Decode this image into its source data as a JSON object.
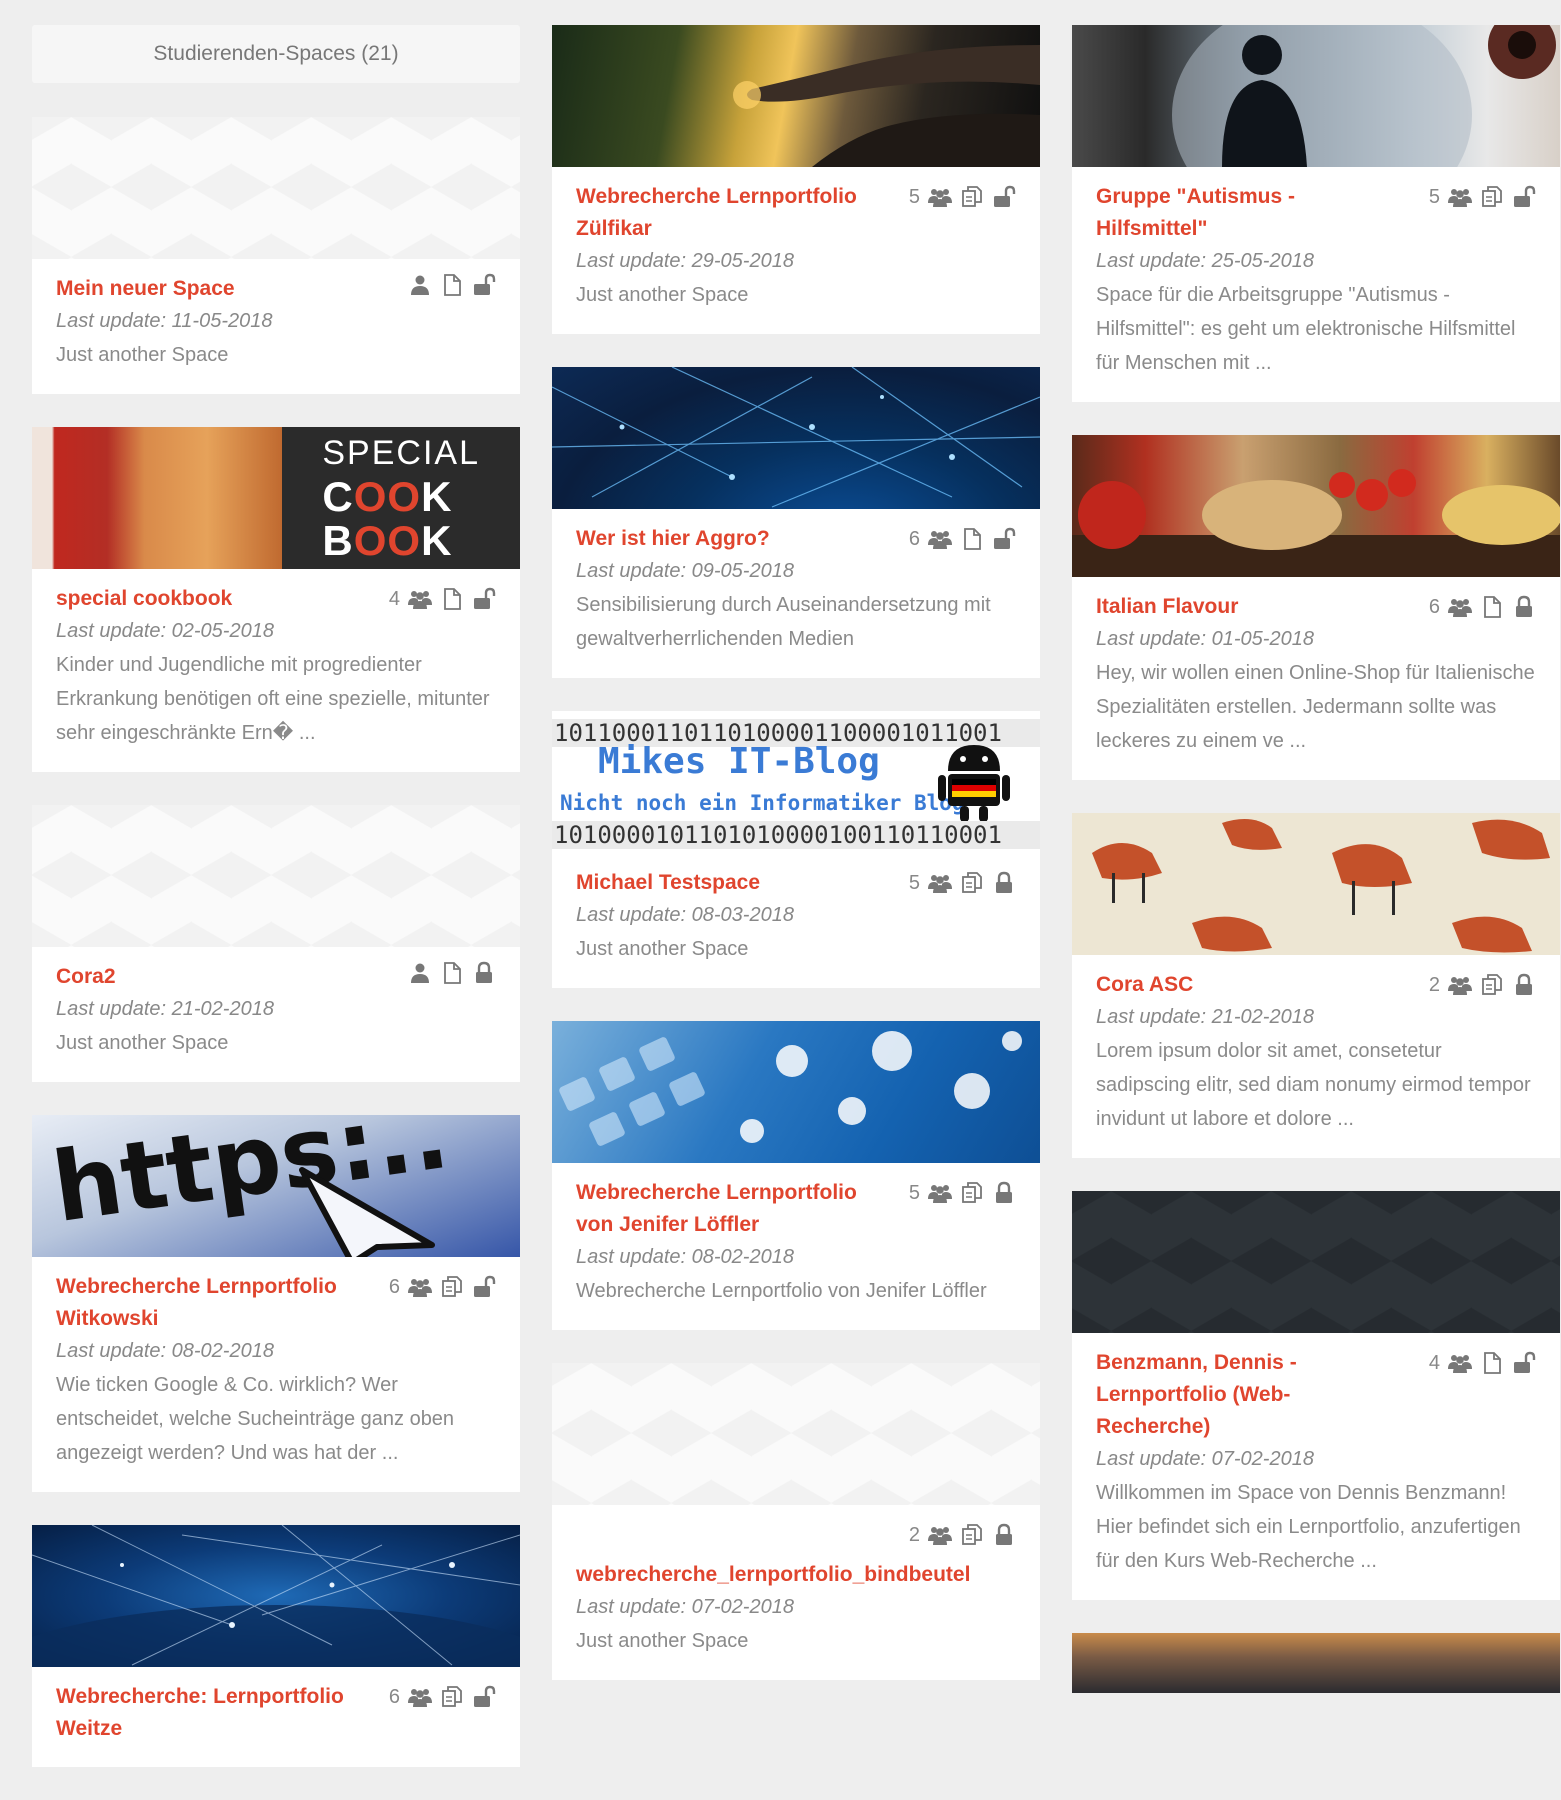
{
  "header": {
    "label": "Studierenden-Spaces (21)"
  },
  "colors": {
    "accent": "#e0452e",
    "meta_text": "#888888",
    "background": "#eeeeee"
  },
  "cards": {
    "c0_0": {
      "title": "Mein neuer Space",
      "member_count": "",
      "member_icon": "user-icon",
      "pages_icon": "page-icon",
      "lock_icon": "unlock-icon",
      "date": "Last update: 11-05-2018",
      "desc": "Just another Space"
    },
    "c0_1": {
      "title": "special cookbook",
      "member_count": "4",
      "member_icon": "users-icon",
      "pages_icon": "page-icon",
      "lock_icon": "unlock-icon",
      "date": "Last update: 02-05-2018",
      "desc": "Kinder und Jugendliche mit progredienter Erkrankung benötigen oft eine spezielle, mitunter sehr eingeschränkte Ern� ...",
      "image_text": {
        "line1": "SPECIAL",
        "line2": "COOK",
        "line3": "BOOK"
      }
    },
    "c0_2": {
      "title": "Cora2",
      "member_count": "",
      "member_icon": "user-icon",
      "pages_icon": "page-icon",
      "lock_icon": "lock-icon",
      "date": "Last update: 21-02-2018",
      "desc": "Just another Space"
    },
    "c0_3": {
      "title": "Webrecherche Lernportfolio Witkowski",
      "member_count": "6",
      "member_icon": "users-icon",
      "pages_icon": "copy-icon",
      "lock_icon": "unlock-icon",
      "date": "Last update: 08-02-2018",
      "desc": "Wie ticken Google & Co. wirklich? Wer entscheidet, welche Sucheinträge ganz oben angezeigt werden? Und was hat der ...",
      "image_text": "https:.."
    },
    "c0_4": {
      "title": "Webrecherche: Lernportfolio Weitze",
      "member_count": "6",
      "member_icon": "users-icon",
      "pages_icon": "copy-icon",
      "lock_icon": "unlock-icon"
    },
    "c1_0": {
      "title": "Webrecherche Lernportfolio Zülfikar",
      "member_count": "5",
      "member_icon": "users-icon",
      "pages_icon": "copy-icon",
      "lock_icon": "unlock-icon",
      "date": "Last update: 29-05-2018",
      "desc": "Just another Space"
    },
    "c1_1": {
      "title": "Wer ist hier Aggro?",
      "member_count": "6",
      "member_icon": "users-icon",
      "pages_icon": "page-icon",
      "lock_icon": "unlock-icon",
      "date": "Last update: 09-05-2018",
      "desc": "Sensibilisierung durch Auseinandersetzung mit gewaltverherrlichenden Medien"
    },
    "c1_2": {
      "title": "Michael Testspace",
      "member_count": "5",
      "member_icon": "users-icon",
      "pages_icon": "copy-icon",
      "lock_icon": "lock-icon",
      "date": "Last update: 08-03-2018",
      "desc": "Just another Space",
      "image_text": {
        "binary_top": "1011000110110100001100001011001",
        "title": "Mikes IT-Blog",
        "subtitle": "Nicht noch ein Informatiker Blog",
        "binary_bottom": "1010000101101010000100110110001"
      }
    },
    "c1_3": {
      "title": "Webrecherche Lernportfolio von Jenifer Löffler",
      "member_count": "5",
      "member_icon": "users-icon",
      "pages_icon": "copy-icon",
      "lock_icon": "lock-icon",
      "date": "Last update: 08-02-2018",
      "desc": "Webrecherche Lernportfolio von Jenifer Löffler"
    },
    "c1_4": {
      "title": "webrecherche_lernportfolio_bindbeutel",
      "member_count": "2",
      "member_icon": "users-icon",
      "pages_icon": "copy-icon",
      "lock_icon": "lock-icon",
      "date": "Last update: 07-02-2018",
      "desc": "Just another Space"
    },
    "c2_0": {
      "title": "Gruppe \"Autismus - Hilfsmittel\"",
      "member_count": "5",
      "member_icon": "users-icon",
      "pages_icon": "copy-icon",
      "lock_icon": "unlock-icon",
      "date": "Last update: 25-05-2018",
      "desc": "Space für die Arbeitsgruppe \"Autismus - Hilfsmittel\": es geht um elektronische Hilfsmittel für Menschen mit ..."
    },
    "c2_1": {
      "title": "Italian Flavour",
      "member_count": "6",
      "member_icon": "users-icon",
      "pages_icon": "page-icon",
      "lock_icon": "lock-icon",
      "date": "Last update: 01-05-2018",
      "desc": "Hey, wir wollen einen Online-Shop für Italienische Spezialitäten erstellen. Jedermann sollte was leckeres zu einem ve ..."
    },
    "c2_2": {
      "title": "Cora ASC",
      "member_count": "2",
      "member_icon": "users-icon",
      "pages_icon": "copy-icon",
      "lock_icon": "lock-icon",
      "date": "Last update: 21-02-2018",
      "desc": "Lorem ipsum dolor sit amet, consetetur sadipscing elitr, sed diam nonumy eirmod tempor invidunt ut labore et dolore ..."
    },
    "c2_3": {
      "title": "Benzmann, Dennis - Lernportfolio (Web-Recherche)",
      "member_count": "4",
      "member_icon": "users-icon",
      "pages_icon": "page-icon",
      "lock_icon": "unlock-icon",
      "date": "Last update: 07-02-2018",
      "desc": "Willkommen im Space von Dennis Benzmann! Hier befindet sich ein Lernportfolio, anzufertigen für den Kurs Web-Recherche ..."
    }
  }
}
